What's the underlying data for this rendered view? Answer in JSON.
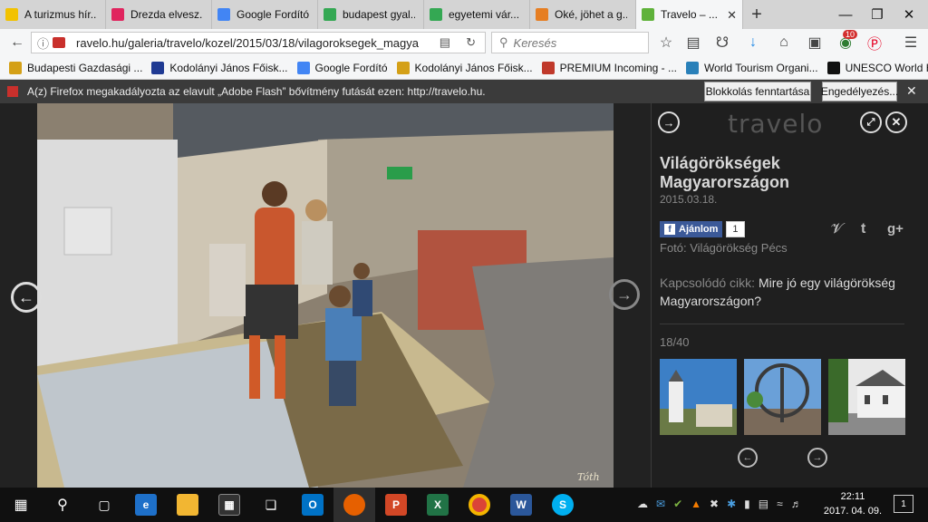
{
  "tabs": [
    {
      "title": "A turizmus hír...",
      "icon_color": "#f2c200"
    },
    {
      "title": "Drezda elvesz...",
      "icon_color": "#e0245e"
    },
    {
      "title": "Google Fordító",
      "icon_color": "#4285f4"
    },
    {
      "title": "budapest gyal...",
      "icon_color": "#34a853"
    },
    {
      "title": "egyetemi vár...",
      "icon_color": "#34a853"
    },
    {
      "title": "Oké, jöhet a g...",
      "icon_color": "#e67e22"
    },
    {
      "title": "Travelo – ...",
      "icon_color": "#5fb23a",
      "active": true
    }
  ],
  "url": "ravelo.hu/galeria/travelo/kozel/2015/03/18/vilagoroksegek_magya",
  "search_placeholder": "Keresés",
  "addon_badge": "10",
  "bookmarks": [
    {
      "label": "Budapesti Gazdasági ...",
      "icon_color": "#d4a017"
    },
    {
      "label": "Kodolányi János Főisk...",
      "icon_color": "#1f3a93"
    },
    {
      "label": "Google Fordító",
      "icon_color": "#4285f4"
    },
    {
      "label": "Kodolányi János Főisk...",
      "icon_color": "#d4a017"
    },
    {
      "label": "PREMIUM Incoming - ...",
      "icon_color": "#c0392b"
    },
    {
      "label": "World Tourism Organi...",
      "icon_color": "#2980b9"
    },
    {
      "label": "UNESCO World Herita...",
      "icon_color": "#111111"
    }
  ],
  "notification": {
    "text": "A(z) Firefox megakadályozta az elavult „Adobe Flash” bővítmény futását ezen: http://travelo.hu.",
    "block_button": "Blokkolás fenntartása",
    "allow_button": "Engedélyezés..."
  },
  "gallery": {
    "logo": "travelo",
    "title": "Világörökségek Magyarországon",
    "date": "2015.03.18.",
    "like_label": "Ajánlom",
    "like_count": "1",
    "photo_credit": "Fotó: Világörökség Pécs",
    "related_prefix": "Kapcsolódó cikk:",
    "related_link": "Mire jó egy világörökség Magyarországon?",
    "counter": "18/40",
    "photo_signature": "Tóth"
  },
  "taskbar": {
    "time": "22:11",
    "date": "2017. 04. 09.",
    "notifications": "1"
  }
}
